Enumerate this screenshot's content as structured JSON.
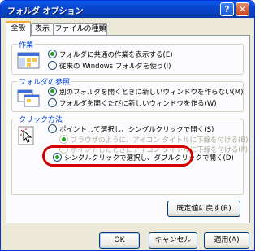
{
  "window": {
    "title": "フォルダ オプション"
  },
  "titlebar": {
    "help_glyph": "?",
    "close_glyph": "✕"
  },
  "tabs": [
    {
      "label": "全般",
      "active": true
    },
    {
      "label": "表示",
      "active": false
    },
    {
      "label": "ファイルの種類",
      "active": false
    }
  ],
  "groups": {
    "tasks": {
      "label": "作業",
      "options": [
        {
          "label": "フォルダに共通の作業を表示する(E)",
          "checked": true
        },
        {
          "label": "従来の Windows フォルダを使う(I)",
          "checked": false
        }
      ]
    },
    "browse": {
      "label": "フォルダの参照",
      "options": [
        {
          "label": "別のフォルダを開くときに新しいウィンドウを作らない(M)",
          "checked": true
        },
        {
          "label": "フォルダを開くたびに新しいウィンドウを作る(W)",
          "checked": false
        }
      ]
    },
    "click": {
      "label": "クリック方法",
      "options": [
        {
          "label": "ポイントして選択し、シングルクリックで開く(S)",
          "checked": false
        },
        {
          "label": "ブラウザのように、アイコン タイトルに下線を付ける(B)",
          "checked": true,
          "disabled": true
        },
        {
          "label": "ポイントしたときにアイコン タイトルに下線を付ける(P)",
          "checked": false,
          "disabled": true
        },
        {
          "label": "シングルクリックで選択し、ダブルクリックで開く(D)",
          "checked": true
        }
      ]
    }
  },
  "buttons": {
    "restore_defaults": "既定値に戻す(R)",
    "ok": "OK",
    "cancel": "キャンセル",
    "apply": "適用(A)"
  },
  "colors": {
    "titlebar": "#0a5ef0",
    "highlight": "#d40000",
    "group_label": "#0046d5"
  }
}
